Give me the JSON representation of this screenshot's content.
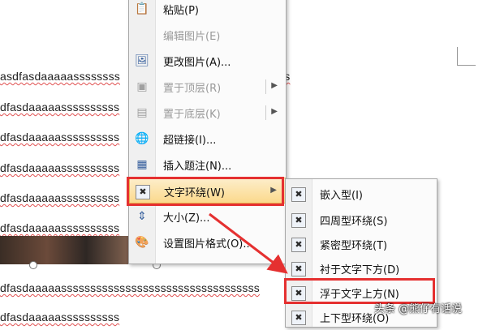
{
  "document": {
    "lines": [
      "asdfasdaaaaassssssss",
      "dfasdaaaaassssssssss",
      "dfasdaaaaassssssssss",
      "dfasdaaaaassssssssss",
      "dfasdaaaaassssssssss",
      "dfasdaaaaassssssssss",
      "dfasdaaaaassssssssssssssssssssssssssssssssss",
      "dfasdaaaaassssssssss"
    ],
    "line1_tail": "ss"
  },
  "context_menu": {
    "items": [
      {
        "label": "粘贴(P)",
        "icon": "clipboard-icon",
        "disabled": false,
        "submenu": false
      },
      {
        "label": "编辑图片(E)",
        "icon": "",
        "disabled": true,
        "submenu": false
      },
      {
        "label": "更改图片(A)...",
        "icon": "change-picture-icon",
        "disabled": false,
        "submenu": false
      },
      {
        "label": "置于顶层(R)",
        "icon": "bring-to-front-icon",
        "disabled": true,
        "submenu": true
      },
      {
        "label": "置于底层(K)",
        "icon": "send-to-back-icon",
        "disabled": true,
        "submenu": true
      },
      {
        "label": "超链接(I)...",
        "icon": "hyperlink-icon",
        "disabled": false,
        "submenu": false
      },
      {
        "label": "插入题注(N)...",
        "icon": "insert-caption-icon",
        "disabled": false,
        "submenu": false
      },
      {
        "label": "文字环绕(W)",
        "icon": "text-wrap-icon",
        "disabled": false,
        "submenu": true,
        "highlighted": true
      },
      {
        "label": "大小(Z)...",
        "icon": "size-icon",
        "disabled": false,
        "submenu": false
      },
      {
        "label": "设置图片格式(O)...",
        "icon": "format-picture-icon",
        "disabled": false,
        "submenu": false
      }
    ]
  },
  "wrap_submenu": {
    "items": [
      {
        "label": "嵌入型(I)",
        "icon": "inline-wrap-icon"
      },
      {
        "label": "四周型环绕(S)",
        "icon": "square-wrap-icon"
      },
      {
        "label": "紧密型环绕(T)",
        "icon": "tight-wrap-icon"
      },
      {
        "label": "衬于文字下方(D)",
        "icon": "behind-text-icon"
      },
      {
        "label": "浮于文字上方(N)",
        "icon": "in-front-of-text-icon",
        "highlighted": true
      },
      {
        "label": "上下型环绕(O)",
        "icon": "top-bottom-wrap-icon"
      }
    ]
  },
  "watermark": "头条 @熊仔有话说",
  "colors": {
    "highlight_box": "#e53030",
    "spellcheck": "#e05050"
  }
}
